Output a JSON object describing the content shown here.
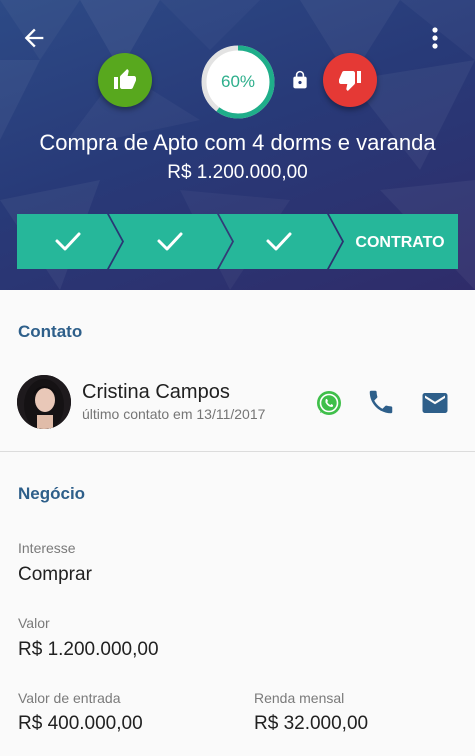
{
  "header": {
    "progress_label": "60%",
    "progress_value": 0.6,
    "title": "Compra de Apto com 4 dorms e varanda",
    "price": "R$ 1.200.000,00",
    "steps": [
      "check",
      "check",
      "check"
    ],
    "current_step_label": "CONTRATO",
    "colors": {
      "step": "#26b79a",
      "like": "#58a81e",
      "dislike": "#e53935"
    }
  },
  "contact": {
    "section_title": "Contato",
    "name": "Cristina Campos",
    "last_contact": "último contato em 13/11/2017",
    "icons": [
      "whatsapp-icon",
      "phone-icon",
      "email-icon"
    ]
  },
  "business": {
    "section_title": "Negócio",
    "fields": [
      {
        "label": "Interesse",
        "value": "Comprar"
      },
      {
        "label": "Valor",
        "value": "R$ 1.200.000,00"
      },
      {
        "label": "Valor de entrada",
        "value": "R$ 400.000,00"
      },
      {
        "label": "Renda mensal",
        "value": "R$ 32.000,00"
      }
    ]
  }
}
